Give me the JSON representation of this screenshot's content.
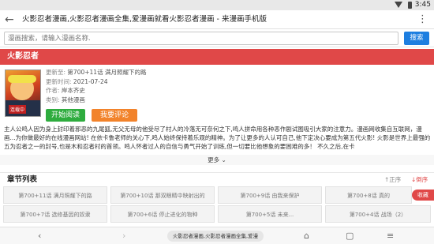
{
  "status": {
    "time": "3:45"
  },
  "titlebar": {
    "title": "火影忍者漫画,火影忍者漫画全集,爱漫画就看火影忍者漫画 - 来漫画手机版"
  },
  "search": {
    "placeholder": "漫画搜索，请输入漫画名称.",
    "button_label": "搜索"
  },
  "comic": {
    "name": "火影忍者",
    "cover_tag": "连载中",
    "update_label": "更新至:",
    "update_value": "第700+11话 满月照耀下的路",
    "time_label": "更新时间:",
    "time_value": "2021-07-24",
    "author_label": "作者:",
    "author_value": "岸本齐史",
    "category_label": "类别:",
    "category_value": "其他漫画",
    "read_button": "开始阅读",
    "comment_button": "我要评论",
    "description": "主人公鸣人因为身上封印着邪恶的九尾狐,无父无母的他受尽了村人的冷落无可奈何之下,鸣人拼命用各种恶作剧试图吸引大家的注意力。漫画网收集自互联网，漫画...为你做最好的在线漫画网站! 在依卡鲁老师的关心下,鸣人始终保持着乐观的精神。为了让更多的人认可自己,他下定决心要成为第五代火影! 火影是世界上最强的五为忍者之一的封号,也是木和忍者村的首领。鸣人怀者过人的自信与勇气开始了训练,但一切要比他想象的要困难的多！ 不久之后,在卡",
    "more_label": "更多"
  },
  "chapters": {
    "header": "章节列表",
    "sort_asc": "正序",
    "sort_desc": "倒序",
    "collapse_label": "收藏",
    "items": [
      "第700+11话 满月照耀下的路",
      "第700+10话 那双眼睛中映射出的",
      "第700+9话 由我来保护",
      "第700+8话 真的",
      "第700+7话 选修基因的奴隶",
      "第700+6话 停止进化的物种",
      "第700+5话 未来...",
      "第700+4话 战场（2）"
    ]
  },
  "bottomnav": {
    "pill_text": "火影忍者漫画,火影忍者漫画全集,爱漫"
  }
}
